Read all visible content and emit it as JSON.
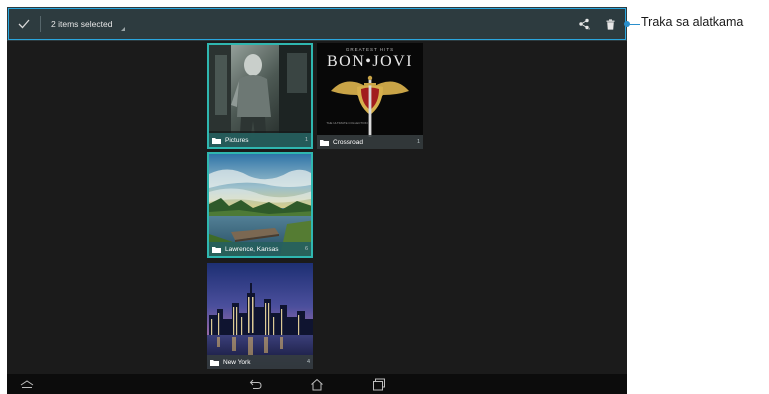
{
  "toolbar": {
    "selection_label": "2 items selected",
    "done_icon": "checkmark-icon",
    "share_icon": "share-icon",
    "delete_icon": "trash-icon"
  },
  "albums": [
    {
      "name": "Pictures",
      "count": "1",
      "selected": true
    },
    {
      "name": "Crossroad",
      "count": "1",
      "selected": false
    },
    {
      "name": "Lawrence, Kansas",
      "count": "6",
      "selected": true
    },
    {
      "name": "New York",
      "count": "4",
      "selected": false
    }
  ],
  "album_art": {
    "crossroad_title_top": "GREATEST HITS",
    "crossroad_title": "BON•JOVI",
    "crossroad_title_bottom": "THE ULTIMATE COLLECTION"
  },
  "navbar": {
    "icons": [
      "collapse-icon",
      "back-icon",
      "home-icon",
      "recent-apps-icon"
    ]
  },
  "annotation": {
    "label": "Traka sa alatkama"
  },
  "colors": {
    "toolbar_bg": "#2d3b3f",
    "highlight": "#2aa6de",
    "selection_border": "#2fb7b0",
    "screen_bg": "#1b1b1b"
  }
}
